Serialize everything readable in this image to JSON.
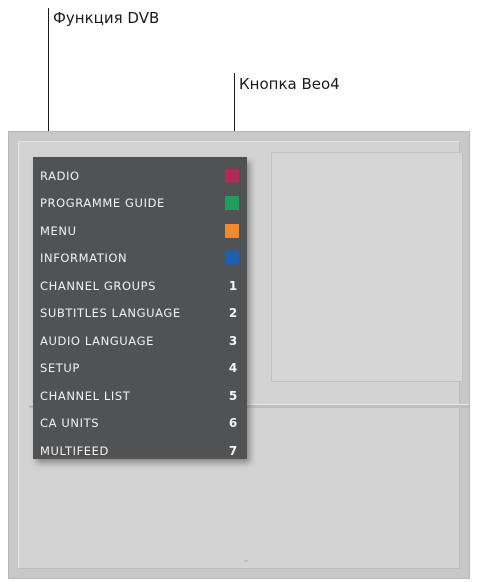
{
  "callouts": {
    "dvb_function": "Функция DVB",
    "beo4_button": "Кнопка Beo4"
  },
  "menu": {
    "items": [
      {
        "label": "RADIO",
        "key_type": "color",
        "key_color": "#b02a55"
      },
      {
        "label": "PROGRAMME GUIDE",
        "key_type": "color",
        "key_color": "#1f9e5c"
      },
      {
        "label": "MENU",
        "key_type": "color",
        "key_color": "#f08a2e"
      },
      {
        "label": "INFORMATION",
        "key_type": "color",
        "key_color": "#1f5fb0"
      },
      {
        "label": "CHANNEL GROUPS",
        "key_type": "number",
        "key": "1"
      },
      {
        "label": "SUBTITLES LANGUAGE",
        "key_type": "number",
        "key": "2"
      },
      {
        "label": "AUDIO LANGUAGE",
        "key_type": "number",
        "key": "3"
      },
      {
        "label": "SETUP",
        "key_type": "number",
        "key": "4"
      },
      {
        "label": "CHANNEL LIST",
        "key_type": "number",
        "key": "5"
      },
      {
        "label": "CA UNITS",
        "key_type": "number",
        "key": "6"
      },
      {
        "label": "MULTIFEED",
        "key_type": "number",
        "key": "7"
      }
    ]
  }
}
